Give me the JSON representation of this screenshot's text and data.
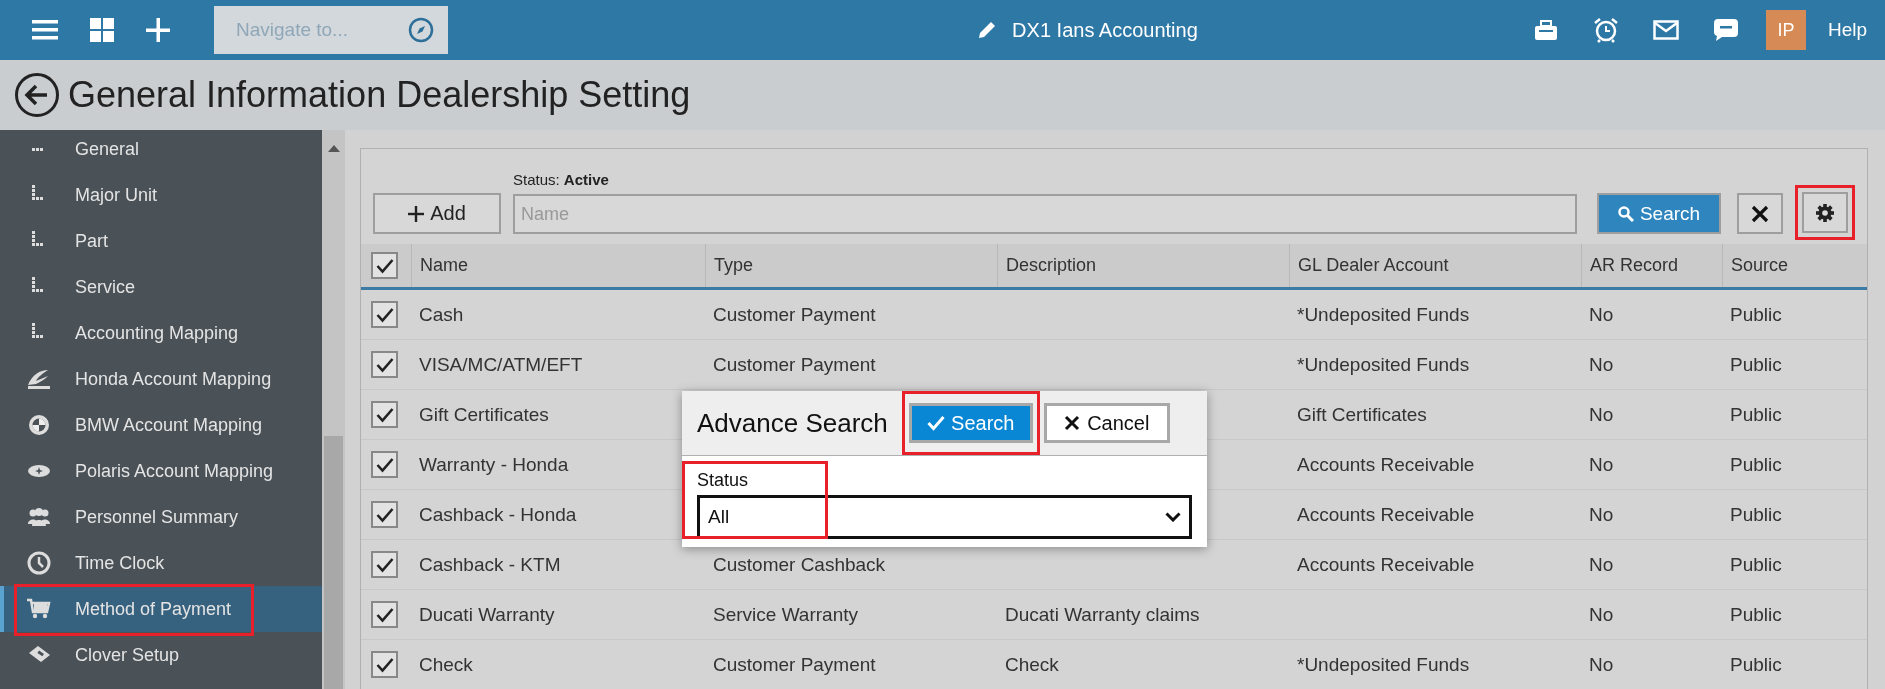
{
  "top_bar": {
    "navigate": {
      "placeholder": "Navigate to..."
    },
    "company": "DX1 Ians Accounting",
    "user_initials": "IP",
    "help": "Help"
  },
  "page_title": "General Information Dealership Setting",
  "sidebar": {
    "items": [
      {
        "label": "General",
        "kind": "sub",
        "selected": false,
        "highlighted": false
      },
      {
        "label": "Major Unit",
        "kind": "sub",
        "selected": false,
        "highlighted": false
      },
      {
        "label": "Part",
        "kind": "sub",
        "selected": false,
        "highlighted": false
      },
      {
        "label": "Service",
        "kind": "sub",
        "selected": false,
        "highlighted": false
      },
      {
        "label": "Accounting Mapping",
        "kind": "sub",
        "selected": false,
        "highlighted": false
      },
      {
        "label": "Honda Account Mapping",
        "kind": "main",
        "selected": false,
        "highlighted": false
      },
      {
        "label": "BMW Account Mapping",
        "kind": "main",
        "selected": false,
        "highlighted": false
      },
      {
        "label": "Polaris Account Mapping",
        "kind": "main",
        "selected": false,
        "highlighted": false
      },
      {
        "label": "Personnel Summary",
        "kind": "main",
        "selected": false,
        "highlighted": false
      },
      {
        "label": "Time Clock",
        "kind": "main",
        "selected": false,
        "highlighted": false
      },
      {
        "label": "Method of Payment",
        "kind": "main",
        "selected": true,
        "highlighted": true
      },
      {
        "label": "Clover Setup",
        "kind": "main",
        "selected": false,
        "highlighted": false
      }
    ]
  },
  "toolbar": {
    "add": "Add",
    "status_label": "Status: **Active**",
    "name_field": {
      "placeholder": "Name"
    },
    "search": "Search",
    "settings_highlighted": true
  },
  "table": {
    "all_checked": true,
    "columns": [
      "Name",
      "Type",
      "Description",
      "GL Dealer Account",
      "AR Record",
      "Source"
    ],
    "rows": [
      {
        "checked": true,
        "cells": [
          "Cash",
          "Customer Payment",
          "",
          "*Undeposited Funds",
          "No",
          "Public"
        ]
      },
      {
        "checked": true,
        "cells": [
          "VISA/MC/ATM/EFT",
          "Customer Payment",
          "",
          "*Undeposited Funds",
          "No",
          "Public"
        ]
      },
      {
        "checked": true,
        "cells": [
          "Gift Certificates",
          "",
          "",
          "Gift Certificates",
          "No",
          "Public"
        ]
      },
      {
        "checked": true,
        "cells": [
          "Warranty - Honda",
          "",
          "",
          "Accounts Receivable",
          "No",
          "Public"
        ]
      },
      {
        "checked": true,
        "cells": [
          "Cashback - Honda",
          "",
          "",
          "Accounts Receivable",
          "No",
          "Public"
        ]
      },
      {
        "checked": true,
        "cells": [
          "Cashback - KTM",
          "Customer Cashback",
          "",
          "Accounts Receivable",
          "No",
          "Public"
        ]
      },
      {
        "checked": true,
        "cells": [
          "Ducati Warranty",
          "Service Warranty",
          "Ducati Warranty claims",
          "",
          "No",
          "Public"
        ]
      },
      {
        "checked": true,
        "cells": [
          "Check",
          "Customer Payment",
          "Check",
          "*Undeposited Funds",
          "No",
          "Public"
        ]
      }
    ]
  },
  "dialog": {
    "title": "Advance Search",
    "search": "Search",
    "search_highlighted": true,
    "cancel": "Cancel",
    "status": {
      "label": "Status",
      "value": "All",
      "highlighted": true
    }
  }
}
